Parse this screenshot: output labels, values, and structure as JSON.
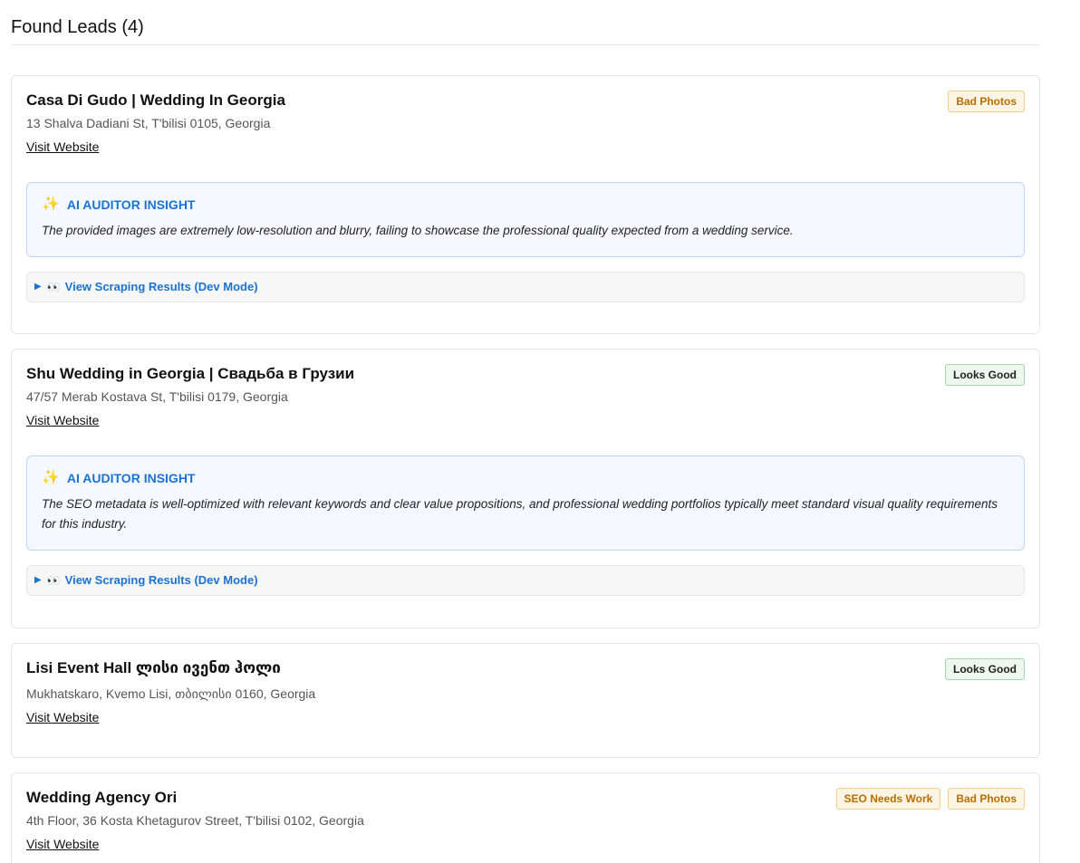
{
  "header": {
    "title": "Found Leads (4)"
  },
  "leads": [
    {
      "name": "Casa Di Gudo | Wedding In Georgia",
      "address": "13 Shalva Dadiani St, T'bilisi 0105, Georgia",
      "link": "Visit Website",
      "badges": [
        {
          "label": "Bad Photos",
          "type": "warn"
        }
      ],
      "insight": {
        "title": "AI AUDITOR INSIGHT",
        "text": "The provided images are extremely low-resolution and blurry, failing to showcase the professional quality expected from a wedding service."
      },
      "dev": "View Scraping Results (Dev Mode)"
    },
    {
      "name": "Shu Wedding in Georgia | Свадьба в Грузии",
      "address": "47/57 Merab Kostava St, T'bilisi 0179, Georgia",
      "link": "Visit Website",
      "badges": [
        {
          "label": "Looks Good",
          "type": "good"
        }
      ],
      "insight": {
        "title": "AI AUDITOR INSIGHT",
        "text": "The SEO metadata is well-optimized with relevant keywords and clear value propositions, and professional wedding portfolios typically meet standard visual quality requirements for this industry."
      },
      "dev": "View Scraping Results (Dev Mode)"
    },
    {
      "name": "Lisi Event Hall ლისი ივენთ ჰოლი",
      "address": "Mukhatskaro, Kvemo Lisi, თბილისი 0160, Georgia",
      "link": "Visit Website",
      "badges": [
        {
          "label": "Looks Good",
          "type": "good"
        }
      ]
    },
    {
      "name": "Wedding Agency Ori",
      "address": "4th Floor, 36 Kosta Khetagurov Street, T'bilisi 0102, Georgia",
      "link": "Visit Website",
      "badges": [
        {
          "label": "SEO Needs Work",
          "type": "warn"
        },
        {
          "label": "Bad Photos",
          "type": "warn"
        }
      ]
    }
  ],
  "colors": {
    "accent": "#1a73d1",
    "warn_text": "#b86e00",
    "warn_bg": "#fdf5e3",
    "good_bg": "#edf7ed"
  },
  "icons": {
    "insight": "sparkles-icon",
    "dev_toggle": "triangle-right-icon",
    "dev_emoji": "eyes-icon"
  }
}
